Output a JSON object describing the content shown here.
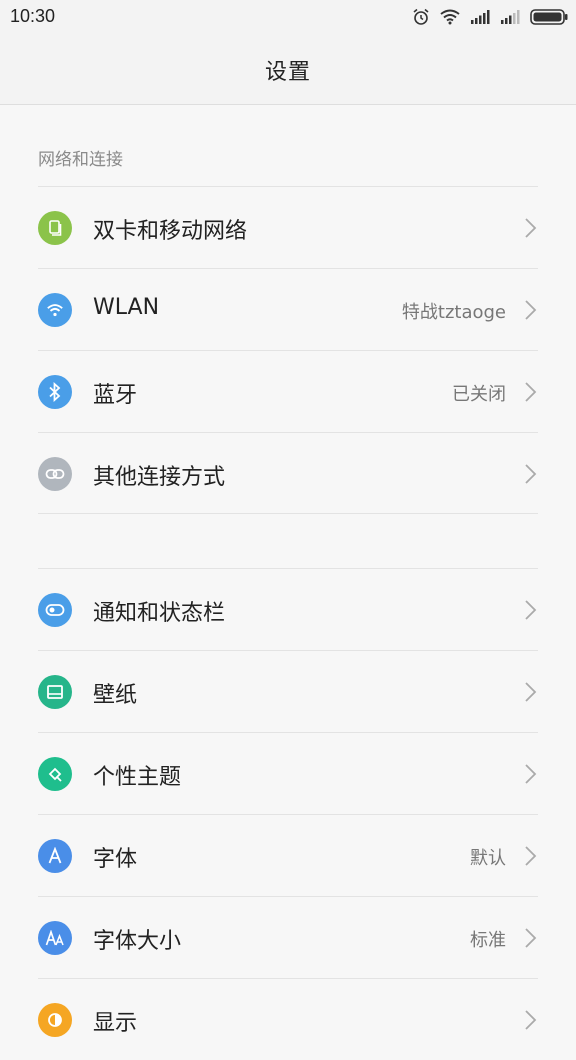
{
  "status_bar": {
    "time": "10:30"
  },
  "header": {
    "title": "设置"
  },
  "sections": [
    {
      "header": "网络和连接",
      "items": [
        {
          "label": "双卡和移动网络",
          "value": "",
          "icon": "sim-card-icon",
          "color": "#8bc34a"
        },
        {
          "label": "WLAN",
          "value": "特战tztaoge",
          "icon": "wifi-icon",
          "color": "#4a9ee8"
        },
        {
          "label": "蓝牙",
          "value": "已关闭",
          "icon": "bluetooth-icon",
          "color": "#4a9ee8"
        },
        {
          "label": "其他连接方式",
          "value": "",
          "icon": "link-icon",
          "color": "#b0b6bd"
        }
      ]
    },
    {
      "header": "",
      "items": [
        {
          "label": "通知和状态栏",
          "value": "",
          "icon": "toggle-icon",
          "color": "#4a9ee8"
        },
        {
          "label": "壁纸",
          "value": "",
          "icon": "wallpaper-icon",
          "color": "#26b58a"
        },
        {
          "label": "个性主题",
          "value": "",
          "icon": "theme-brush-icon",
          "color": "#1fbe8d"
        },
        {
          "label": "字体",
          "value": "默认",
          "icon": "font-icon",
          "color": "#4a8ee8"
        },
        {
          "label": "字体大小",
          "value": "标准",
          "icon": "font-size-icon",
          "color": "#4a8ee8"
        },
        {
          "label": "显示",
          "value": "",
          "icon": "display-icon",
          "color": "#f5a623"
        }
      ]
    }
  ]
}
